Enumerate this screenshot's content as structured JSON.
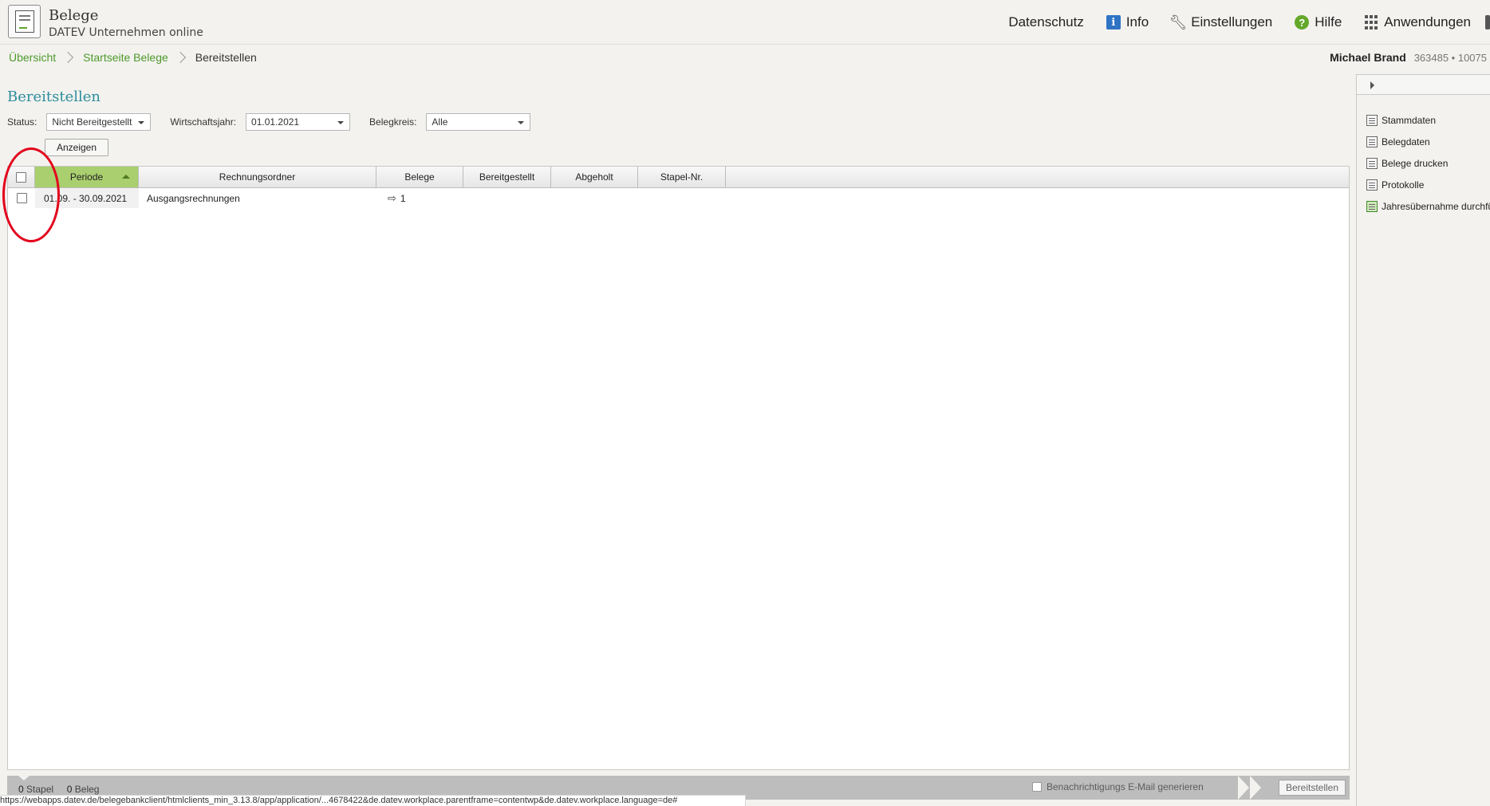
{
  "header": {
    "app_title": "Belege",
    "app_subtitle": "DATEV Unternehmen online",
    "nav": [
      {
        "label": "Datenschutz",
        "icon": "none"
      },
      {
        "label": "Info",
        "icon": "info-icon"
      },
      {
        "label": "Einstellungen",
        "icon": "wrench-icon"
      },
      {
        "label": "Hilfe",
        "icon": "help-icon"
      },
      {
        "label": "Anwendungen",
        "icon": "grid-icon"
      }
    ]
  },
  "breadcrumb": {
    "items": [
      "Übersicht",
      "Startseite Belege"
    ],
    "current": "Bereitstellen"
  },
  "user": {
    "name": "Michael Brand",
    "ids": "363485 • 10075"
  },
  "page": {
    "title": "Bereitstellen"
  },
  "filters": {
    "status_label": "Status:",
    "status_value": "Nicht Bereitgestellt",
    "year_label": "Wirtschaftsjahr:",
    "year_value": "01.01.2021",
    "circle_label": "Belegkreis:",
    "circle_value": "Alle",
    "show_button": "Anzeigen"
  },
  "table": {
    "columns": [
      "Periode",
      "Rechnungsordner",
      "Belege",
      "Bereitgestellt",
      "Abgeholt",
      "Stapel-Nr."
    ],
    "sorted_column": "Periode",
    "rows": [
      {
        "periode": "01.09. - 30.09.2021",
        "rechnungsordner": "Ausgangsrechnungen",
        "belege": "1",
        "bereitgestellt": "",
        "abgeholt": "",
        "stapel": ""
      }
    ]
  },
  "statusbar": {
    "stapel_count": "0",
    "stapel_label": "Stapel",
    "beleg_count": "0",
    "beleg_label": "Beleg",
    "email_label": "Benachrichtigungs E-Mail generieren",
    "submit_button": "Bereitstellen"
  },
  "sidebar": {
    "items": [
      {
        "label": "Stammdaten",
        "icon": "card-icon"
      },
      {
        "label": "Belegdaten",
        "icon": "document-icon"
      },
      {
        "label": "Belege drucken",
        "icon": "printer-icon"
      },
      {
        "label": "Protokolle",
        "icon": "log-icon"
      },
      {
        "label": "Jahresübernahme durchfü",
        "icon": "calendar-icon"
      }
    ]
  },
  "url_status": "https://webapps.datev.de/belegebankclient/htmlclients_min_3.13.8/app/application/...4678422&de.datev.workplace.parentframe=contentwp&de.datev.workplace.language=de#",
  "colors": {
    "accent_green": "#4e9a2a",
    "title_teal": "#2d8d9b",
    "sorted_header": "#a9cf6e",
    "annotation_red": "#e3001b"
  }
}
